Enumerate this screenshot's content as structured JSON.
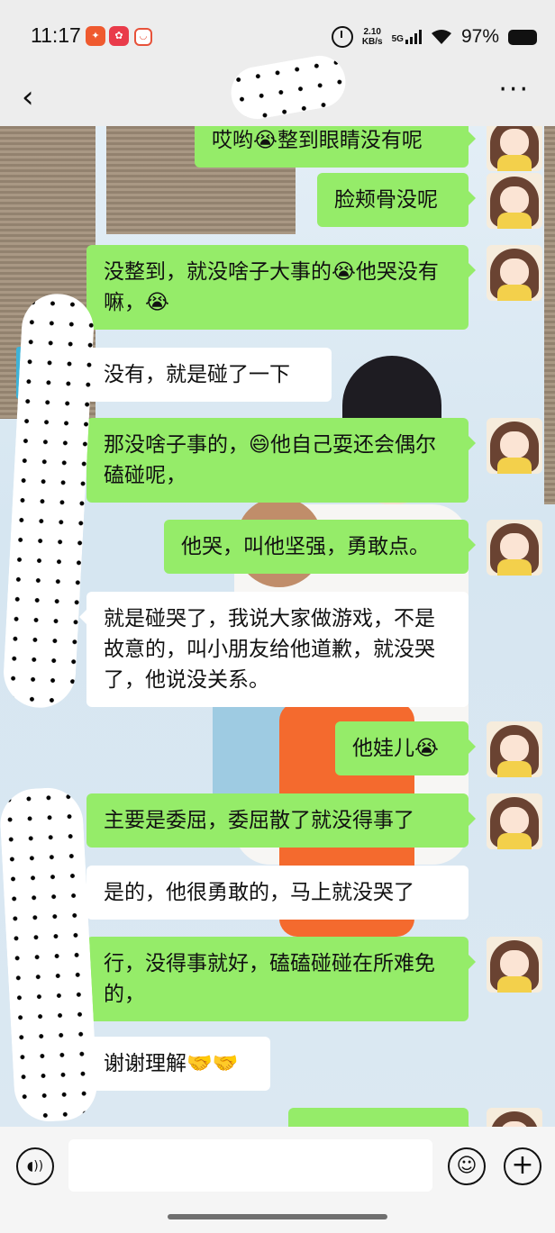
{
  "status_bar": {
    "time": "11:17",
    "net_speed_value": "2.10",
    "net_speed_unit": "KB/s",
    "network": "5G",
    "battery": "97%"
  },
  "header": {
    "back_icon": "chevron-left-icon",
    "more_icon": "more-dots-icon",
    "contact_name_redacted": true
  },
  "messages": [
    {
      "side": "out",
      "text": "哎哟😭整到眼睛没有呢"
    },
    {
      "side": "out",
      "text": "脸颊骨没呢"
    },
    {
      "side": "out",
      "text": "没整到，就没啥子大事的😭他哭没有嘛，😭"
    },
    {
      "side": "in",
      "text": "没有，就是碰了一下"
    },
    {
      "side": "out",
      "text": "那没啥子事的，😄他自己耍还会偶尔磕碰呢，"
    },
    {
      "side": "out",
      "text": "他哭，叫他坚强，勇敢点。"
    },
    {
      "side": "in",
      "text": "就是碰哭了，我说大家做游戏，不是故意的，叫小朋友给他道歉，就没哭了，他说没关系。"
    },
    {
      "side": "out",
      "text": "他娃儿😭"
    },
    {
      "side": "out",
      "text": "主要是委屈，委屈散了就没得事了"
    },
    {
      "side": "in",
      "text": "是的，他很勇敢的，马上就没哭了"
    },
    {
      "side": "out",
      "text": "行，没得事就好，磕磕碰碰在所难免的，"
    },
    {
      "side": "in",
      "text": "谢谢理解🤝🤝"
    }
  ],
  "input_bar": {
    "voice_icon": "voice-icon",
    "emoji_icon": "emoji-icon",
    "plus_icon": "plus-icon",
    "placeholder": ""
  }
}
